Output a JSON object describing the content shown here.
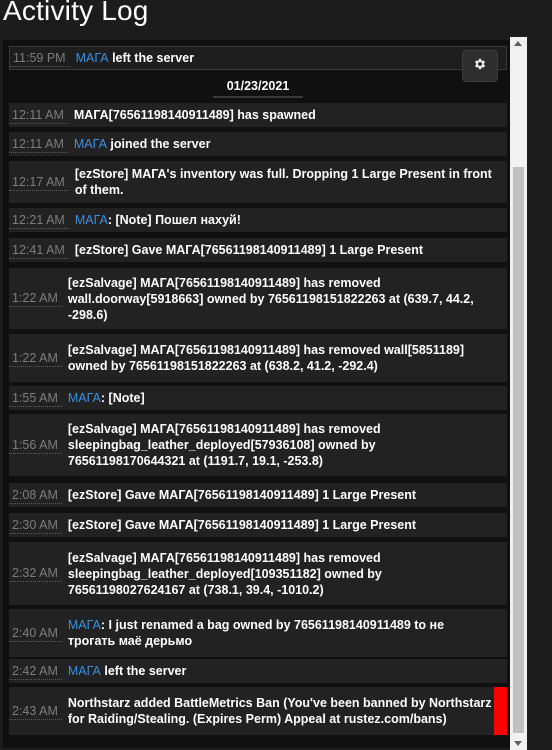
{
  "title": "Activity Log",
  "date_separator": "01/23/2021",
  "entries": [
    {
      "time": "11:59 PM",
      "player": "МАГА",
      "text": " left the server"
    },
    {
      "time": "12:11 AM",
      "player": "",
      "text": "МАГА[76561198140911489] has spawned"
    },
    {
      "time": "12:11 AM",
      "player": "МАГА",
      "text": " joined the server"
    },
    {
      "time": "12:17 AM",
      "player": "",
      "text": "[ezStore] МАГА's inventory was full. Dropping 1 Large Present in front of them."
    },
    {
      "time": "12:21 AM",
      "player": "МАГА",
      "text": ": [Note] Пошел нахуй!"
    },
    {
      "time": "12:41 AM",
      "player": "",
      "text": "[ezStore] Gave МАГА[76561198140911489] 1 Large Present"
    },
    {
      "time": "1:22 AM",
      "player": "",
      "text": "[ezSalvage] МАГА[76561198140911489] has removed wall.doorway[5918663] owned by 76561198151822263 at (639.7, 44.2, -298.6)"
    },
    {
      "time": "1:22 AM",
      "player": "",
      "text": "[ezSalvage] МАГА[76561198140911489] has removed wall[5851189] owned by 76561198151822263 at (638.2, 41.2, -292.4)"
    },
    {
      "time": "1:55 AM",
      "player": "МАГА",
      "text": ": [Note]"
    },
    {
      "time": "1:56 AM",
      "player": "",
      "text": "[ezSalvage] МАГА[76561198140911489] has removed sleepingbag_leather_deployed[57936108] owned by 76561198170644321 at (1191.7, 19.1, -253.8)"
    },
    {
      "time": "2:08 AM",
      "player": "",
      "text": "[ezStore] Gave МАГА[76561198140911489] 1 Large Present"
    },
    {
      "time": "2:30 AM",
      "player": "",
      "text": "[ezStore] Gave МАГА[76561198140911489] 1 Large Present"
    },
    {
      "time": "2:32 AM",
      "player": "",
      "text": "[ezSalvage] МАГА[76561198140911489] has removed sleepingbag_leather_deployed[109351182] owned by 76561198027624167 at (738.1, 39.4, -1010.2)"
    },
    {
      "time": "2:40 AM",
      "player": "МАГА",
      "text": ": I just renamed a bag owned by 76561198140911489 to не трогать маё дерьмо"
    },
    {
      "time": "2:42 AM",
      "player": "МАГА",
      "text": " left the server"
    },
    {
      "time": "2:43 AM",
      "player": "",
      "text": "Northstarz added BattleMetrics Ban (You've been banned by Northstarz for Raiding/Stealing. (Expires Perm) Appeal at rustez.com/bans)"
    }
  ],
  "colors": {
    "player_link": "#3a8fe0",
    "ban_marker": "#ff0000"
  }
}
